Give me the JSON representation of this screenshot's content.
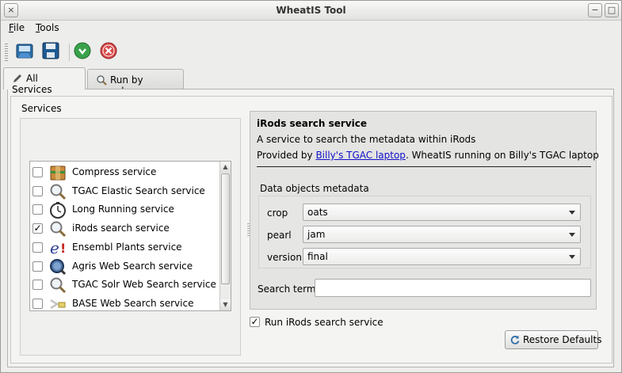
{
  "window": {
    "title": "WheatIS Tool",
    "close_glyph": "×",
    "min_glyph": "−",
    "max_glyph": "□"
  },
  "menubar": {
    "items": [
      {
        "label": "File",
        "mnemonic": "F",
        "rest": "ile"
      },
      {
        "label": "Tools",
        "mnemonic": "T",
        "rest": "ools"
      }
    ]
  },
  "toolbar": {
    "icons": [
      "open-icon",
      "save-icon",
      "run-icon",
      "cancel-icon"
    ]
  },
  "tabs": [
    {
      "label": "All Services",
      "icon": "pencil-icon",
      "active": true
    },
    {
      "label": "Run by search",
      "icon": "magnifier-icon",
      "active": false
    }
  ],
  "services": {
    "label": "Services",
    "items": [
      {
        "label": "Compress service",
        "checked": false,
        "icon": "archive-icon"
      },
      {
        "label": "TGAC Elastic Search service",
        "checked": false,
        "icon": "magnifier-icon"
      },
      {
        "label": "Long Running service",
        "checked": false,
        "icon": "stopwatch-icon"
      },
      {
        "label": "iRods search service",
        "checked": true,
        "icon": "magnifier-icon"
      },
      {
        "label": "Ensembl Plants service",
        "checked": false,
        "icon": "ensembl-e-icon"
      },
      {
        "label": "Agris Web Search service",
        "checked": false,
        "icon": "globe-magnifier-icon"
      },
      {
        "label": "TGAC Solr Web Search service",
        "checked": false,
        "icon": "magnifier-icon"
      },
      {
        "label": "BASE Web Search service",
        "checked": false,
        "icon": "base-arrow-icon"
      }
    ],
    "check_glyph": "✓"
  },
  "detail": {
    "title": "iRods search service",
    "description": "A service to search the metadata within iRods",
    "provided_prefix": "Provided by ",
    "provider_link": "Billy's TGAC laptop",
    "provided_suffix": ". WheatIS running on Billy's TGAC laptop",
    "metadata_label": "Data objects metadata",
    "metadata": [
      {
        "key": "crop",
        "value": "oats"
      },
      {
        "key": "pearl",
        "value": "jam"
      },
      {
        "key": "version",
        "value": "final"
      }
    ],
    "search_label": "Search term",
    "search_value": ""
  },
  "run_checkbox": {
    "label": "Run iRods search service",
    "checked": true,
    "glyph": "✓"
  },
  "restore_button": {
    "label": "Restore Defaults"
  },
  "colors": {
    "link": "#1010c8",
    "window_bg": "#ededec",
    "panel_bg": "#e4e4e2"
  }
}
